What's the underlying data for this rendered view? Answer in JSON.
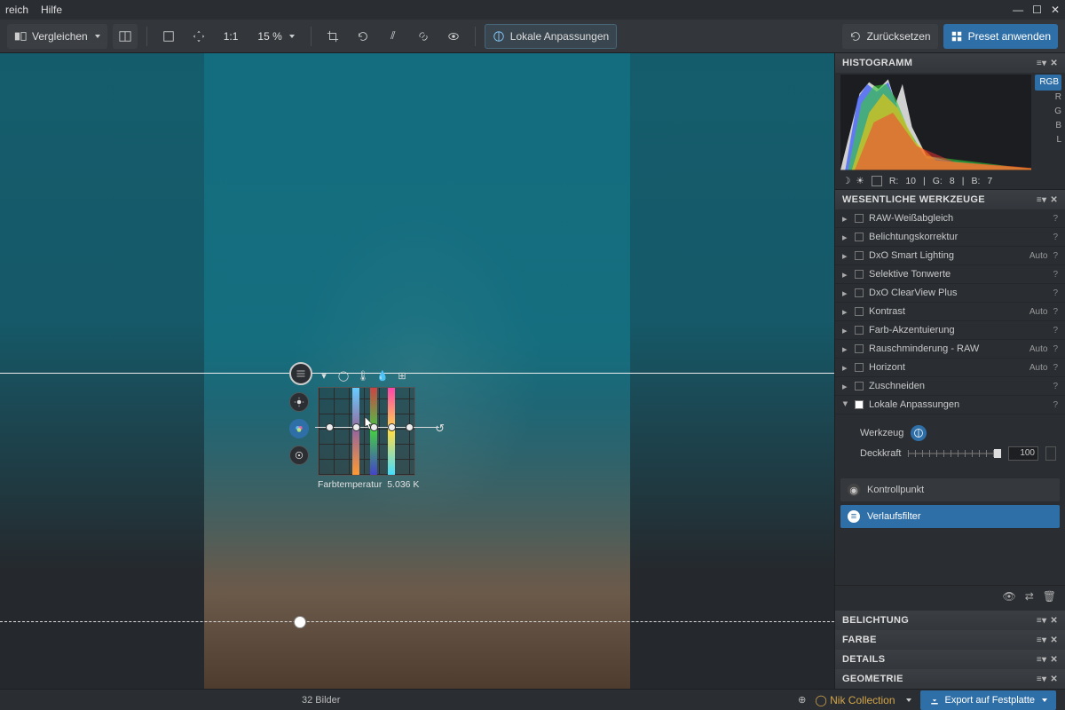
{
  "menu": {
    "file_area": "reich",
    "help": "Hilfe"
  },
  "toolbar": {
    "compare": "Vergleichen",
    "zoom_ratio": "1:1",
    "zoom_pct": "15 %",
    "local": "Lokale Anpassungen",
    "reset": "Zurücksetzen",
    "preset": "Preset anwenden"
  },
  "picker": {
    "label": "Farbtemperatur",
    "value": "5.036 K"
  },
  "panels": {
    "histogram": {
      "title": "HISTOGRAMM",
      "tabs": [
        "RGB",
        "R",
        "G",
        "B",
        "L"
      ],
      "readout": {
        "R": "10",
        "G": "8",
        "B": "7",
        "r_label": "R:",
        "g_label": "G:",
        "b_label": "B:"
      }
    },
    "essential": {
      "title": "WESENTLICHE WERKZEUGE",
      "rows": [
        {
          "label": "RAW-Weißabgleich",
          "auto": "",
          "q": "?"
        },
        {
          "label": "Belichtungskorrektur",
          "auto": "",
          "q": "?"
        },
        {
          "label": "DxO Smart Lighting",
          "auto": "Auto",
          "q": "?"
        },
        {
          "label": "Selektive Tonwerte",
          "auto": "",
          "q": "?"
        },
        {
          "label": "DxO ClearView Plus",
          "auto": "",
          "q": "?"
        },
        {
          "label": "Kontrast",
          "auto": "Auto",
          "q": "?"
        },
        {
          "label": "Farb-Akzentuierung",
          "auto": "",
          "q": "?"
        },
        {
          "label": "Rauschminderung - RAW",
          "auto": "Auto",
          "q": "?"
        },
        {
          "label": "Horizont",
          "auto": "Auto",
          "q": "?"
        },
        {
          "label": "Zuschneiden",
          "auto": "",
          "q": "?"
        }
      ],
      "local": {
        "label": "Lokale Anpassungen",
        "tool_label": "Werkzeug",
        "opacity_label": "Deckkraft",
        "opacity_value": "100",
        "masks": [
          {
            "label": "Kontrollpunkt"
          },
          {
            "label": "Verlaufsfilter"
          }
        ]
      }
    },
    "groups": [
      "BELICHTUNG",
      "FARBE",
      "DETAILS",
      "GEOMETRIE"
    ]
  },
  "bottom": {
    "count": "32 Bilder",
    "nik": "Nik Collection",
    "export": "Export auf Festplatte"
  }
}
